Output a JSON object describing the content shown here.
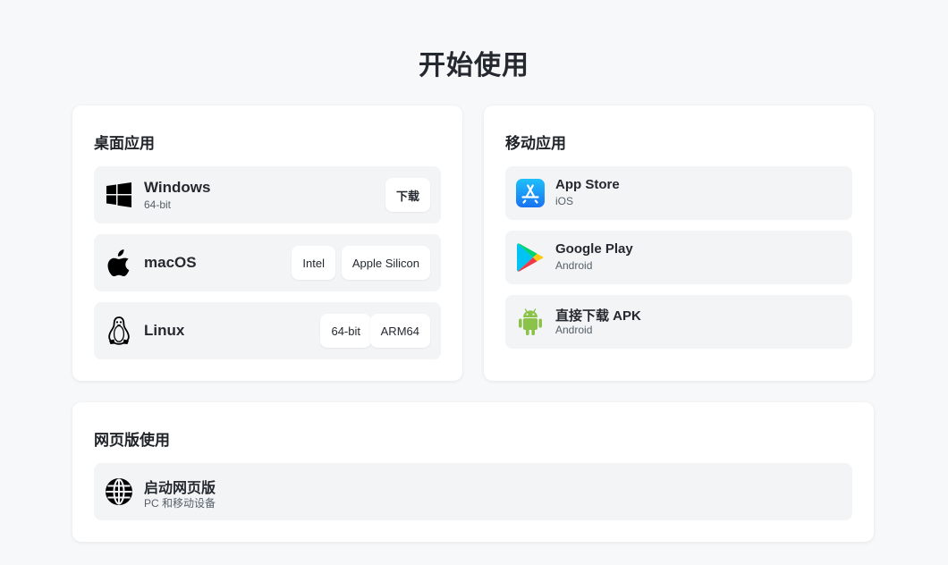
{
  "page_title": "开始使用",
  "desktop": {
    "title": "桌面应用",
    "windows": {
      "name": "Windows",
      "sub": "64-bit",
      "download_label": "下载",
      "icon": "windows-logo-icon"
    },
    "macos": {
      "name": "macOS",
      "intel_label": "Intel",
      "apple_silicon_label": "Apple Silicon",
      "icon": "apple-logo-icon"
    },
    "linux": {
      "name": "Linux",
      "x64_label": "64-bit",
      "arm64_label": "ARM64",
      "icon": "linux-tux-icon"
    }
  },
  "mobile": {
    "title": "移动应用",
    "appstore": {
      "name": "App Store",
      "sub": "iOS",
      "icon": "app-store-icon"
    },
    "googleplay": {
      "name": "Google Play",
      "sub": "Android",
      "icon": "google-play-icon"
    },
    "apk": {
      "name": "直接下载 APK",
      "sub": "Android",
      "icon": "android-icon"
    }
  },
  "web": {
    "title": "网页版使用",
    "launch": {
      "name": "启动网页版",
      "sub": "PC 和移动设备",
      "icon": "globe-icon"
    }
  },
  "colors": {
    "background": "#f7f8fa",
    "card": "#ffffff",
    "row": "#f3f4f6",
    "app_store_blue": "#1a8cf8",
    "android_green": "#8bc34a"
  }
}
